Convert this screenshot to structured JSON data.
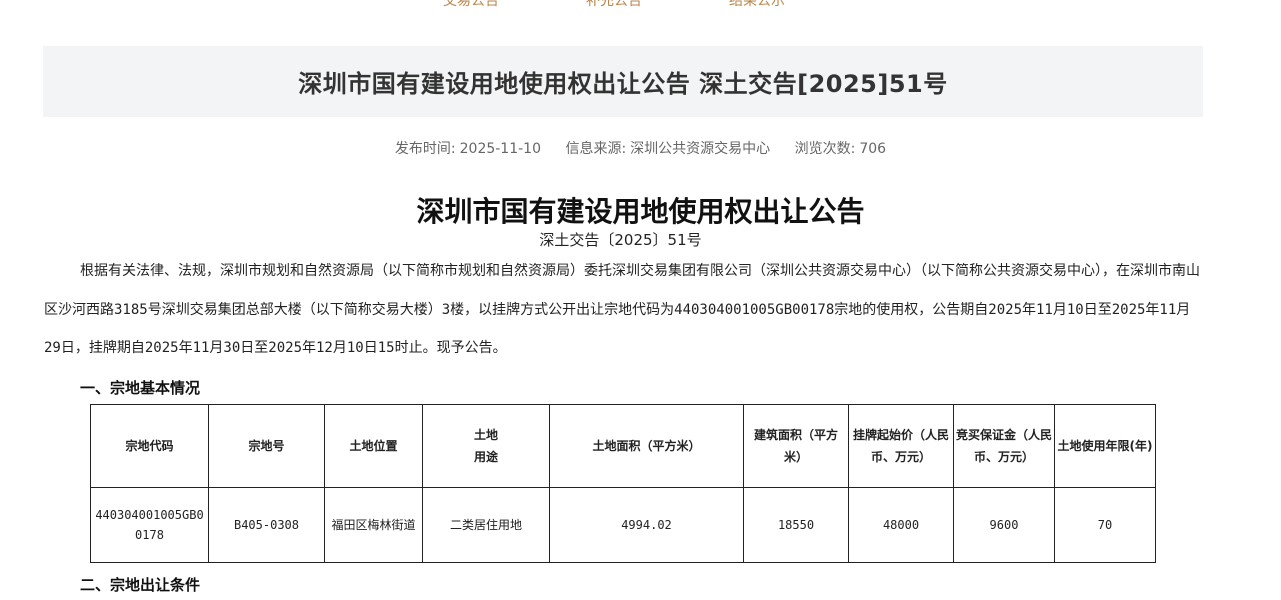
{
  "top_nav": [
    "交易公告",
    "补充公告",
    "结果公示"
  ],
  "page_title": "深圳市国有建设用地使用权出让公告 深土交告[2025]51号",
  "meta": {
    "publish_label": "发布时间:",
    "publish_date": "2025-11-10",
    "source_label": "信息来源:",
    "source": "深圳公共资源交易中心",
    "views_label": "浏览次数:",
    "views": "706"
  },
  "document": {
    "title": "深圳市国有建设用地使用权出让公告",
    "number": "深土交告〔2025〕51号",
    "intro": "根据有关法律、法规，深圳市规划和自然资源局（以下简称市规划和自然资源局）委托深圳交易集团有限公司（深圳公共资源交易中心）（以下简称公共资源交易中心），在深圳市南山区沙河西路3185号深圳交易集团总部大楼（以下简称交易大楼）3楼，以挂牌方式公开出让宗地代码为440304001005GB00178宗地的使用权，公告期自2025年11月10日至2025年11月29日，挂牌期自2025年11月30日至2025年12月10日15时止。现予公告。",
    "section1": "一、宗地基本情况",
    "section2": "二、宗地出让条件"
  },
  "table": {
    "headers": [
      "宗地代码",
      "宗地号",
      "土地位置",
      "土地\n用途",
      "土地面积（平方米）",
      "建筑面积（平方米）",
      "挂牌起始价（人民币、万元）",
      "竞买保证金（人民币、万元）",
      "土地使用年限(年)"
    ],
    "rows": [
      [
        "440304001005GB00178",
        "B405-0308",
        "福田区梅林街道",
        "二类居住用地",
        "4994.02",
        "18550",
        "48000",
        "9600",
        "70"
      ]
    ]
  }
}
